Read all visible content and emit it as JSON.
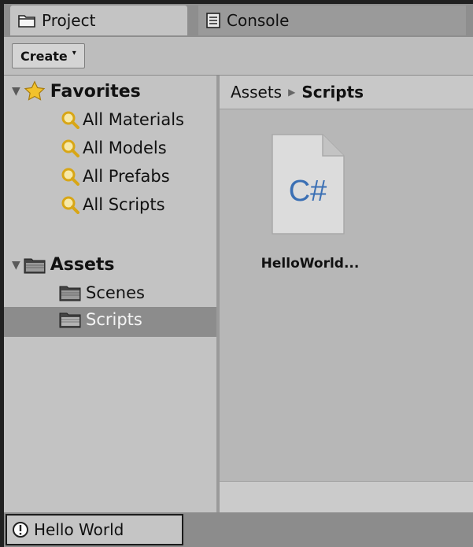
{
  "tabs": [
    {
      "label": "Project",
      "icon": "folder-icon",
      "active": true
    },
    {
      "label": "Console",
      "icon": "console-icon",
      "active": false
    }
  ],
  "toolbar": {
    "create_label": "Create"
  },
  "tree": {
    "favorites": {
      "label": "Favorites",
      "items": [
        "All Materials",
        "All Models",
        "All Prefabs",
        "All Scripts"
      ]
    },
    "assets": {
      "label": "Assets",
      "items": [
        "Scenes",
        "Scripts"
      ],
      "selected": "Scripts"
    }
  },
  "breadcrumb": {
    "root": "Assets",
    "current": "Scripts"
  },
  "files": [
    {
      "name": "HelloWorld...",
      "glyph": "C#",
      "icon": "csharp-script-icon"
    }
  ],
  "status": {
    "label": "Hello World",
    "icon": "info-icon"
  },
  "colors": {
    "csharp_glyph": "#3a6fb4",
    "star": "#f2c22c",
    "search_lens": "#e1b62a"
  }
}
